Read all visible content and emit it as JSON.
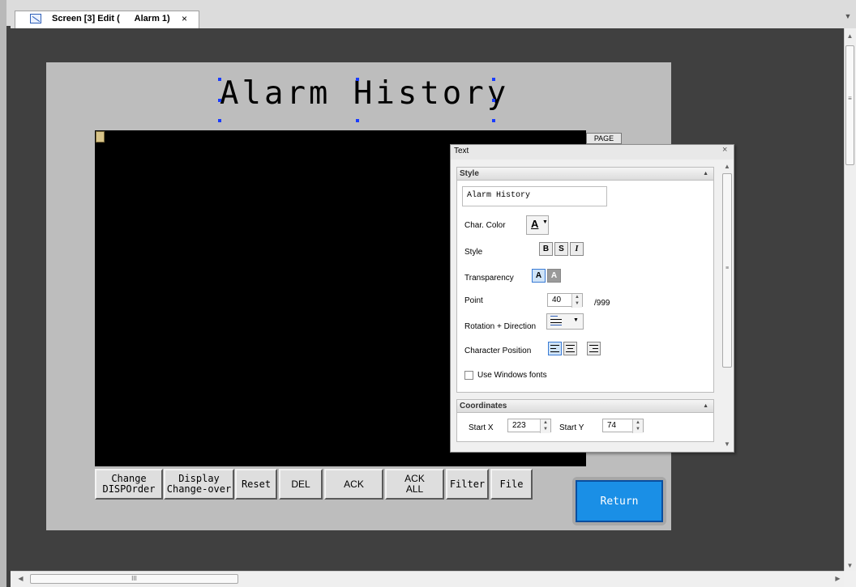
{
  "tab": {
    "label": "Screen [3] Edit (      Alarm 1)",
    "close": "×"
  },
  "screen": {
    "title": "Alarm History",
    "page_button": "PAGE",
    "buttons": [
      {
        "line1": "Change",
        "line2": "DISPOrder"
      },
      {
        "line1": "Display",
        "line2": "Change-over"
      },
      {
        "line1": "Reset"
      },
      {
        "line1": "DEL"
      },
      {
        "line1": "ACK"
      },
      {
        "line1": "ACK",
        "line2": "ALL"
      },
      {
        "line1": "Filter"
      },
      {
        "line1": "File"
      }
    ],
    "return_label": "Return",
    "colors": {
      "canvas": "#404040",
      "screen_bg": "#bdbdbd",
      "return_button": "#1a8fe6"
    }
  },
  "scrollbars": {
    "grip": "≡",
    "hgrip": "III"
  },
  "panel": {
    "title": "Text",
    "close": "×",
    "style_section": {
      "header": "Style",
      "text_value": "Alarm History",
      "char_color_label": "Char. Color",
      "char_color_glyph": "A",
      "style_label": "Style",
      "bold": "B",
      "shadow": "S",
      "italic": "I",
      "transparency_label": "Transparency",
      "transparency_opts": [
        "A",
        "A"
      ],
      "point_label": "Point",
      "point_value": "40",
      "point_max": "/999",
      "rotation_label": "Rotation + Direction",
      "char_position_label": "Character Position",
      "use_windows_fonts": "Use Windows fonts"
    },
    "coordinates_section": {
      "header": "Coordinates",
      "start_x_label": "Start X",
      "start_x_value": "223",
      "start_y_label": "Start Y",
      "start_y_value": "74"
    }
  }
}
